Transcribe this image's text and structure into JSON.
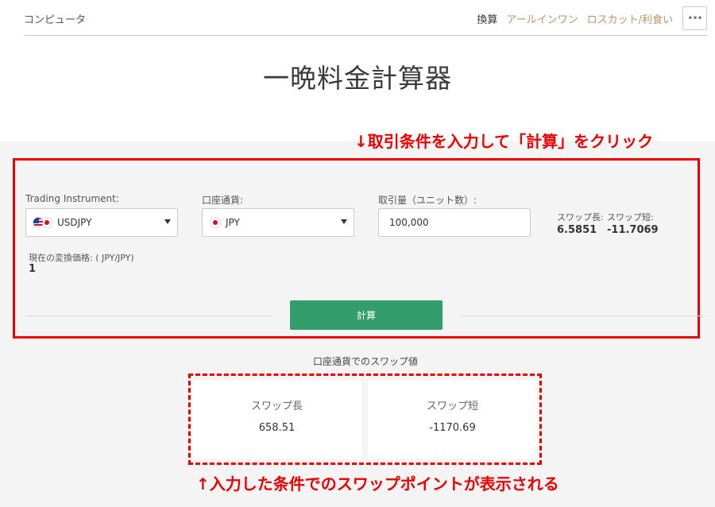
{
  "header": {
    "brand": "コンピュータ",
    "nav": [
      {
        "label": "換算",
        "active": true
      },
      {
        "label": "アールインワン",
        "active": false
      },
      {
        "label": "ロスカット/利食い",
        "active": false
      }
    ],
    "more_icon": "•••"
  },
  "page_title": "一晩料金計算器",
  "annotations": {
    "top": "↓取引条件を入力して「計算」をクリック",
    "bottom": "↑入力した条件でのスワップポイントが表示される",
    "color": "#ee0000"
  },
  "form": {
    "instrument": {
      "label": "Trading Instrument:",
      "value": "USDJPY",
      "icon": "us-jp-flag-icon"
    },
    "account_currency": {
      "label": "口座通貨:",
      "value": "JPY",
      "icon": "jp-flag-icon"
    },
    "volume": {
      "label": "取引量（ユニット数）:",
      "value": "100,000"
    },
    "swap_long": {
      "label": "スワップ長:",
      "value": "6.5851"
    },
    "swap_short": {
      "label": "スワップ短:",
      "value": "-11.7069"
    },
    "conversion": {
      "label": "現在の変換価格: ( JPY/JPY)",
      "value": "1"
    },
    "calculate_label": "計算"
  },
  "results": {
    "title": "口座通貨でのスワップ値",
    "long": {
      "label": "スワップ長",
      "value": "658.51"
    },
    "short": {
      "label": "スワップ短",
      "value": "-1170.69"
    }
  },
  "colors": {
    "accent_green": "#339e6c",
    "nav_link": "#b8956a",
    "background_grey": "#f4f4f4"
  }
}
